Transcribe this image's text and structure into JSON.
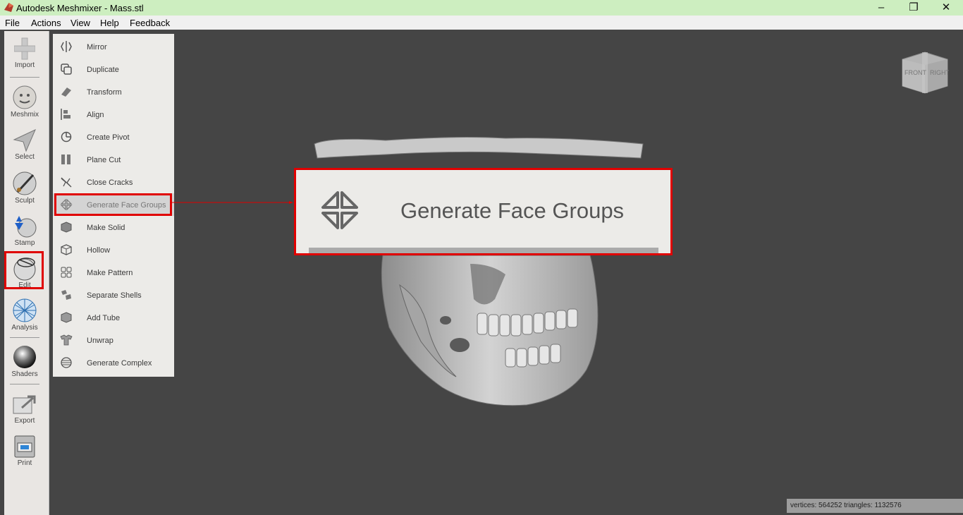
{
  "window": {
    "title": "Autodesk Meshmixer - Mass.stl",
    "controls": {
      "minimize": "–",
      "restore": "❐",
      "close": "✕"
    }
  },
  "menubar": [
    "File",
    "Actions",
    "View",
    "Help",
    "Feedback"
  ],
  "left_toolbar": [
    {
      "label": "Import",
      "icon": "plus-icon"
    },
    {
      "label": "Meshmix",
      "icon": "meshmix-icon"
    },
    {
      "label": "Select",
      "icon": "arrow-select-icon"
    },
    {
      "label": "Sculpt",
      "icon": "brush-icon"
    },
    {
      "label": "Stamp",
      "icon": "stamp-icon"
    },
    {
      "label": "Edit",
      "icon": "edit-sphere-icon",
      "active": true
    },
    {
      "label": "Analysis",
      "icon": "analysis-sphere-icon"
    },
    {
      "label": "Shaders",
      "icon": "shader-sphere-icon"
    },
    {
      "label": "Export",
      "icon": "export-icon"
    },
    {
      "label": "Print",
      "icon": "printer-icon"
    }
  ],
  "edit_menu": [
    {
      "label": "Mirror",
      "icon": "mirror-icon"
    },
    {
      "label": "Duplicate",
      "icon": "duplicate-icon"
    },
    {
      "label": "Transform",
      "icon": "transform-icon"
    },
    {
      "label": "Align",
      "icon": "align-icon"
    },
    {
      "label": "Create Pivot",
      "icon": "pivot-icon"
    },
    {
      "label": "Plane Cut",
      "icon": "plane-cut-icon"
    },
    {
      "label": "Close Cracks",
      "icon": "close-cracks-icon"
    },
    {
      "label": "Generate Face Groups",
      "icon": "face-groups-icon",
      "selected": true
    },
    {
      "label": "Make Solid",
      "icon": "make-solid-icon"
    },
    {
      "label": "Hollow",
      "icon": "hollow-icon"
    },
    {
      "label": "Make Pattern",
      "icon": "make-pattern-icon"
    },
    {
      "label": "Separate Shells",
      "icon": "separate-shells-icon"
    },
    {
      "label": "Add Tube",
      "icon": "add-tube-icon"
    },
    {
      "label": "Unwrap",
      "icon": "unwrap-icon"
    },
    {
      "label": "Generate Complex",
      "icon": "generate-complex-icon"
    }
  ],
  "nav_cube": {
    "front": "FRONT",
    "right": "RIGHT"
  },
  "zoom_callout": {
    "label": "Generate Face Groups",
    "icon": "face-groups-icon"
  },
  "status": "vertices: 564252 triangles: 1132576",
  "colors": {
    "highlight": "#e00000",
    "titlebar": "#cdeec0",
    "viewport": "#454545"
  }
}
